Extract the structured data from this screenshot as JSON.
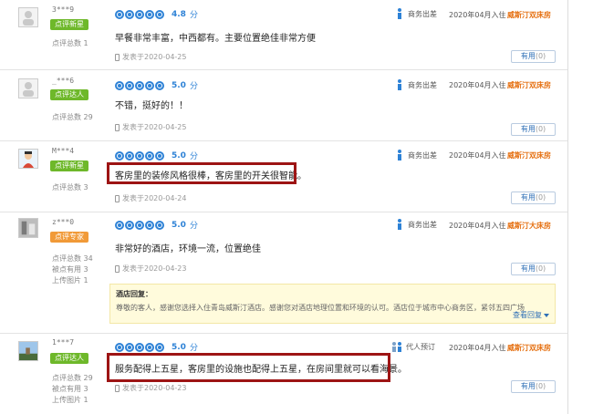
{
  "useful_label": "有用",
  "reviews": [
    {
      "user": "3***9",
      "level": "点评新星",
      "stats": [
        "点评总数 1"
      ],
      "score": "4.8",
      "score_unit": "分",
      "trip": "商务出差",
      "stay": "2020年04月入住",
      "room": "威斯汀双床房",
      "content": "早餐非常丰富，中西都有。主要位置绝佳非常方便",
      "date": "发表于2020-04-25",
      "useful_count": "(0)"
    },
    {
      "user": "_***6",
      "level": "点评达人",
      "stats": [
        "点评总数 29"
      ],
      "score": "5.0",
      "score_unit": "分",
      "trip": "商务出差",
      "stay": "2020年04月入住",
      "room": "威斯汀双床房",
      "content": "不错，挺好的！！",
      "date": "发表于2020-04-25",
      "useful_count": "(0)"
    },
    {
      "user": "M***4",
      "level": "点评新星",
      "stats": [
        "点评总数 3"
      ],
      "score": "5.0",
      "score_unit": "分",
      "trip": "商务出差",
      "stay": "2020年04月入住",
      "room": "威斯汀双床房",
      "content": "客房里的装修风格很棒，客房里的开关很智能。",
      "date": "发表于2020-04-24",
      "useful_count": "(0)"
    },
    {
      "user": "z***0",
      "level": "点评专家",
      "stats": [
        "点评总数 34",
        "被点有用 3",
        "上传图片 1"
      ],
      "score": "5.0",
      "score_unit": "分",
      "trip": "商务出差",
      "stay": "2020年04月入住",
      "room": "威斯汀大床房",
      "content": "非常好的酒店，环境一流，位置绝佳",
      "date": "发表于2020-04-23",
      "useful_count": "(0)",
      "reply": {
        "title": "酒店回复：",
        "text": "尊敬的客人，感谢您选择入住青岛威斯汀酒店。感谢您对酒店地理位置和环境的认可。酒店位于城市中心商务区，紧邻五四广场",
        "more": "查看回复"
      }
    },
    {
      "user": "1***7",
      "level": "点评达人",
      "stats": [
        "点评总数 29",
        "被点有用 3",
        "上传图片 1"
      ],
      "score": "5.0",
      "score_unit": "分",
      "trip": "代人预订",
      "stay": "2020年04月入住",
      "room": "威斯汀双床房",
      "content": "服务配得上五星，客房里的设施也配得上五星，在房间里就可以看海景。",
      "date": "发表于2020-04-23",
      "useful_count": "(0)"
    }
  ],
  "colors": {
    "brand_blue": "#2e82d6",
    "room_orange": "#e56e0e",
    "highlight_red": "#9d1414",
    "level_green": "#6eb82a",
    "level_orange": "#f19a38"
  }
}
